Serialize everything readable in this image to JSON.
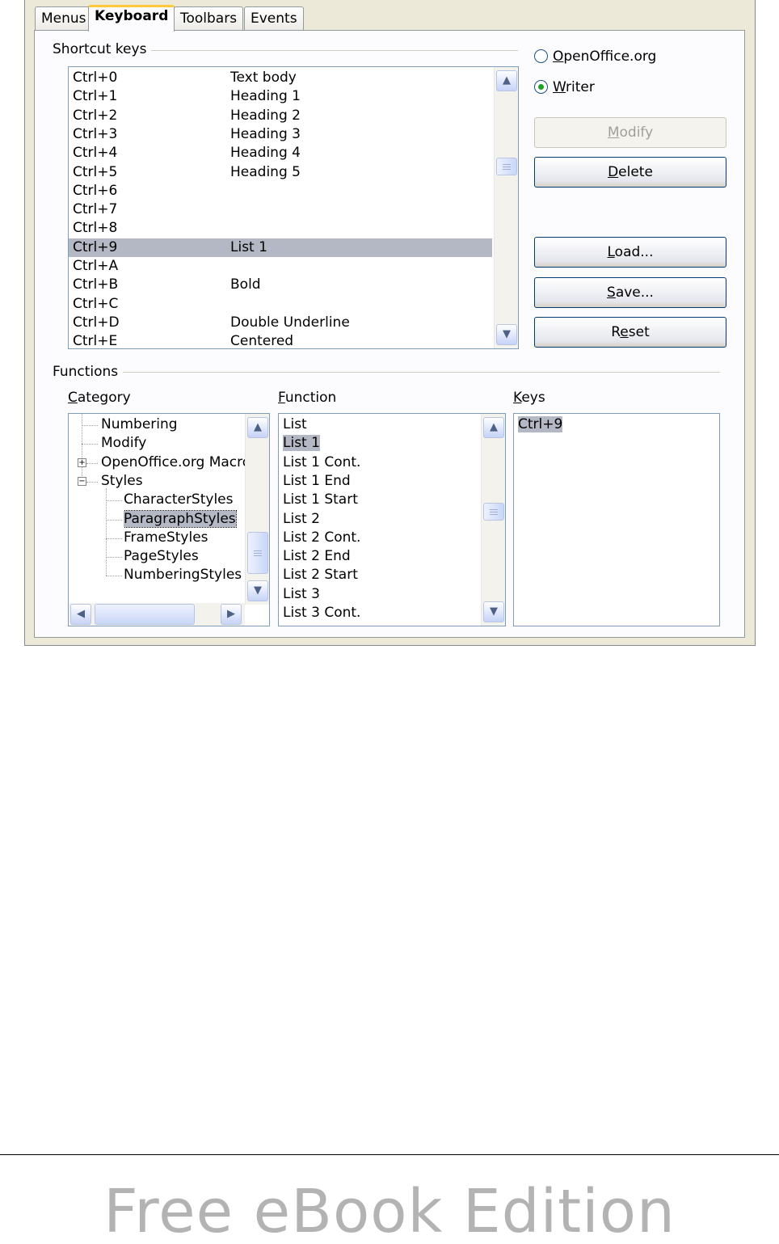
{
  "tabs": [
    "Menus",
    "Keyboard",
    "Toolbars",
    "Events"
  ],
  "active_tab": "Keyboard",
  "shortcut_keys": {
    "label": "Shortcut keys",
    "rows": [
      {
        "key": "Ctrl+0",
        "command": "Text body"
      },
      {
        "key": "Ctrl+1",
        "command": "Heading 1"
      },
      {
        "key": "Ctrl+2",
        "command": "Heading 2"
      },
      {
        "key": "Ctrl+3",
        "command": "Heading 3"
      },
      {
        "key": "Ctrl+4",
        "command": "Heading 4"
      },
      {
        "key": "Ctrl+5",
        "command": "Heading 5"
      },
      {
        "key": "Ctrl+6",
        "command": ""
      },
      {
        "key": "Ctrl+7",
        "command": ""
      },
      {
        "key": "Ctrl+8",
        "command": ""
      },
      {
        "key": "Ctrl+9",
        "command": "List 1"
      },
      {
        "key": "Ctrl+A",
        "command": ""
      },
      {
        "key": "Ctrl+B",
        "command": "Bold"
      },
      {
        "key": "Ctrl+C",
        "command": ""
      },
      {
        "key": "Ctrl+D",
        "command": "Double Underline"
      },
      {
        "key": "Ctrl+E",
        "command": "Centered"
      }
    ],
    "selected_key": "Ctrl+9"
  },
  "radios": {
    "openoffice": {
      "label_u": "O",
      "label_rest": "penOffice.org",
      "checked": false
    },
    "writer": {
      "label_u": "W",
      "label_rest": "riter",
      "checked": true
    }
  },
  "buttons": {
    "modify": {
      "u": "M",
      "rest": "odify",
      "enabled": false
    },
    "delete": {
      "u": "D",
      "rest": "elete",
      "enabled": true
    },
    "load": {
      "u": "L",
      "rest": "oad...",
      "enabled": true
    },
    "save": {
      "u": "S",
      "rest": "ave...",
      "enabled": true
    },
    "reset": {
      "pre": "R",
      "u": "e",
      "rest": "set",
      "enabled": true
    }
  },
  "functions": {
    "label": "Functions",
    "category_label_u": "C",
    "category_label_rest": "ategory",
    "function_label_u": "F",
    "function_label_rest": "unction",
    "keys_label_u": "K",
    "keys_label_rest": "eys",
    "categories": [
      {
        "label": "Numbering",
        "level": 0,
        "expander": ""
      },
      {
        "label": "Modify",
        "level": 0,
        "expander": ""
      },
      {
        "label": "OpenOffice.org Macros",
        "level": 0,
        "expander": "+"
      },
      {
        "label": "Styles",
        "level": 0,
        "expander": "−"
      },
      {
        "label": "CharacterStyles",
        "level": 1,
        "expander": ""
      },
      {
        "label": "ParagraphStyles",
        "level": 1,
        "expander": ""
      },
      {
        "label": "FrameStyles",
        "level": 1,
        "expander": ""
      },
      {
        "label": "PageStyles",
        "level": 1,
        "expander": ""
      },
      {
        "label": "NumberingStyles",
        "level": 1,
        "expander": ""
      }
    ],
    "selected_category": "ParagraphStyles",
    "functions": [
      "List",
      "List 1",
      "List 1 Cont.",
      "List 1 End",
      "List 1 Start",
      "List 2",
      "List 2 Cont.",
      "List 2 End",
      "List 2 Start",
      "List 3",
      "List 3 Cont."
    ],
    "selected_function": "List 1",
    "keys": [
      "Ctrl+9"
    ]
  },
  "footer": {
    "watermark": "Free eBook Edition"
  }
}
